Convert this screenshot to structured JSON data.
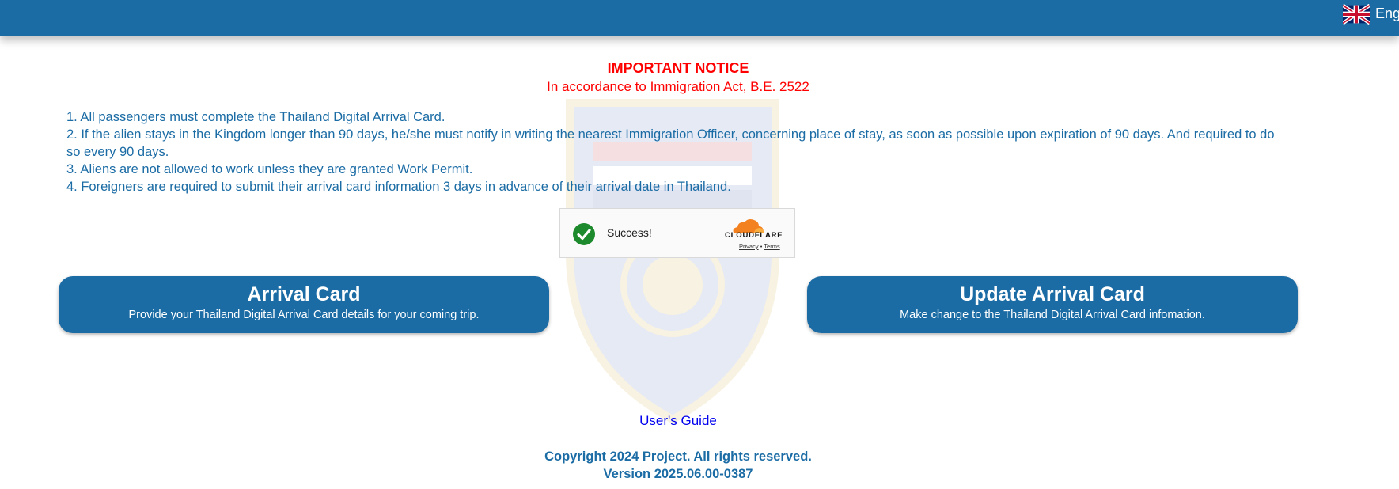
{
  "header": {
    "language_label": "English"
  },
  "notice": {
    "title": "IMPORTANT NOTICE",
    "subtitle": "In accordance to Immigration Act, B.E. 2522",
    "rules": [
      "1. All passengers must complete the Thailand Digital Arrival Card.",
      "2. If the alien stays in the Kingdom longer than 90 days, he/she must notify in writing the nearest Immigration Officer, concerning place of stay, as soon as possible upon expiration of 90 days. And required to do so every 90 days.",
      "3. Aliens are not allowed to work unless they are granted Work Permit.",
      "4. Foreigners are required to submit their arrival card information 3 days in advance of their arrival date in Thailand."
    ]
  },
  "captcha": {
    "status": "Success!",
    "brand": "CLOUDFLARE",
    "privacy_label": "Privacy",
    "separator": "•",
    "terms_label": "Terms"
  },
  "actions": {
    "arrival_card": {
      "title": "Arrival Card",
      "description": "Provide your Thailand Digital Arrival Card details for your coming trip."
    },
    "update_arrival_card": {
      "title": "Update Arrival Card",
      "description": "Make change to the Thailand Digital Arrival Card infomation."
    }
  },
  "footer": {
    "user_guide": "User's Guide",
    "copyright": "Copyright 2024 Project. All rights reserved.",
    "version": "Version 2025.06.00-0387"
  },
  "colors": {
    "primary": "#1b6ca5",
    "notice": "#ff0000",
    "success": "#1e8a2e",
    "cloudflare": "#f48120"
  }
}
